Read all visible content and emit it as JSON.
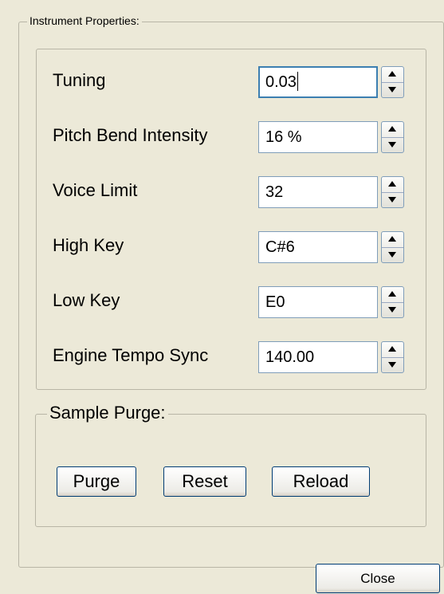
{
  "instrument_properties": {
    "title": "Instrument Properties:",
    "fields": [
      {
        "label": "Tuning",
        "value": "0.03",
        "focused": true
      },
      {
        "label": "Pitch Bend Intensity",
        "value": "16 %"
      },
      {
        "label": "Voice Limit",
        "value": "32"
      },
      {
        "label": "High Key",
        "value": "C#6"
      },
      {
        "label": "Low Key",
        "value": "E0"
      },
      {
        "label": "Engine Tempo Sync",
        "value": "140.00"
      }
    ]
  },
  "sample_purge": {
    "title": "Sample Purge:",
    "purge_label": "Purge",
    "reset_label": "Reset",
    "reload_label": "Reload"
  },
  "footer": {
    "close_label": "Close"
  },
  "icons": {
    "spin_up": "spin-up-arrow-icon",
    "spin_down": "spin-down-arrow-icon"
  },
  "colors": {
    "background": "#ece9d8",
    "field_border": "#7f9db9",
    "focus_border": "#3c7fb1"
  }
}
